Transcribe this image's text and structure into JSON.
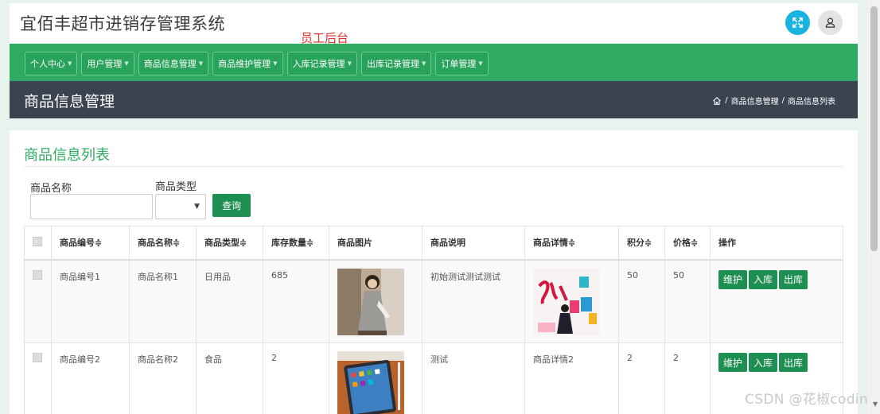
{
  "header": {
    "app_title": "宜佰丰超市进销存管理系统",
    "staff_label": "员工后台",
    "expand_icon": "expand-arrows-icon",
    "user_icon": "user-icon",
    "expand_color": "#1ab3e0"
  },
  "nav": {
    "items": [
      {
        "label": "个人中心"
      },
      {
        "label": "用户管理"
      },
      {
        "label": "商品信息管理"
      },
      {
        "label": "商品维护管理"
      },
      {
        "label": "入库记录管理"
      },
      {
        "label": "出库记录管理"
      },
      {
        "label": "订单管理"
      }
    ],
    "accent": "#2eaa62"
  },
  "page_header": {
    "title": "商品信息管理",
    "breadcrumb": [
      "商品信息管理",
      "商品信息列表"
    ],
    "separator": "/"
  },
  "card": {
    "title": "商品信息列表",
    "search": {
      "name_label": "商品名称",
      "name_value": "",
      "type_label": "商品类型",
      "type_value": "",
      "query_label": "查询"
    }
  },
  "table": {
    "columns": [
      "商品编号",
      "商品名称",
      "商品类型",
      "库存数量",
      "商品图片",
      "商品说明",
      "商品详情",
      "积分",
      "价格",
      "操作"
    ],
    "sort_glyph": "≑",
    "rows": [
      {
        "code": "商品编号1",
        "name": "商品名称1",
        "type": "日用品",
        "stock": "685",
        "image": "woman-in-grey-dress-photo",
        "desc": "初始测试测试测试",
        "detail": "",
        "detail_image": "shopping-poster",
        "points": "50",
        "price": "50",
        "actions": [
          "维护",
          "入库",
          "出库"
        ]
      },
      {
        "code": "商品编号2",
        "name": "商品名称2",
        "type": "食品",
        "stock": "2",
        "image": "tablet-photo",
        "desc": "测试",
        "detail": "商品详情2",
        "detail_image": "",
        "points": "2",
        "price": "2",
        "actions": [
          "维护",
          "入库",
          "出库"
        ]
      }
    ]
  },
  "watermark": "CSDN @花椒coding"
}
